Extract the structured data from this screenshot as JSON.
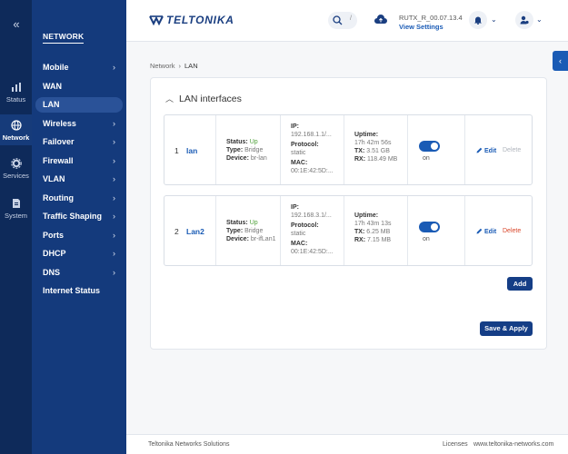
{
  "rail": {
    "items": [
      {
        "label": "Status",
        "icon": "bar-chart-icon"
      },
      {
        "label": "Network",
        "icon": "globe-icon"
      },
      {
        "label": "Services",
        "icon": "gear-icon"
      },
      {
        "label": "System",
        "icon": "system-icon"
      }
    ]
  },
  "subnav": {
    "title": "NETWORK",
    "items": [
      {
        "label": "Mobile",
        "chevron": true
      },
      {
        "label": "WAN",
        "chevron": false
      },
      {
        "label": "LAN",
        "chevron": false,
        "active": true
      },
      {
        "label": "Wireless",
        "chevron": true
      },
      {
        "label": "Failover",
        "chevron": true
      },
      {
        "label": "Firewall",
        "chevron": true
      },
      {
        "label": "VLAN",
        "chevron": true
      },
      {
        "label": "Routing",
        "chevron": true
      },
      {
        "label": "Traffic Shaping",
        "chevron": true
      },
      {
        "label": "Ports",
        "chevron": true
      },
      {
        "label": "DHCP",
        "chevron": true
      },
      {
        "label": "DNS",
        "chevron": true
      },
      {
        "label": "Internet Status",
        "chevron": false
      }
    ]
  },
  "header": {
    "logo_text": "TELTONIKA",
    "search_shortcut": "/",
    "firmware": "RUTX_R_00.07.13.4",
    "view_settings": "View Settings"
  },
  "breadcrumb": {
    "parent": "Network",
    "current": "LAN"
  },
  "panel": {
    "title": "LAN interfaces",
    "add_label": "Add",
    "save_label": "Save & Apply"
  },
  "interfaces": [
    {
      "index": "1",
      "name": "lan",
      "status_key": "Status:",
      "status": "Up",
      "type_key": "Type:",
      "type": "Bridge",
      "device_key": "Device:",
      "device": "br-lan",
      "ip_key": "IP:",
      "ip": "192.168.1.1/...",
      "protocol_key": "Protocol:",
      "protocol": "static",
      "mac_key": "MAC:",
      "mac": "00:1E:42:5D:...",
      "uptime_key": "Uptime:",
      "uptime": "17h 42m 56s",
      "tx_key": "TX:",
      "tx": "3.51 GB",
      "rx_key": "RX:",
      "rx": "118.49 MB",
      "toggle": "on",
      "edit": "Edit",
      "delete": "Delete",
      "delete_enabled": false
    },
    {
      "index": "2",
      "name": "Lan2",
      "status_key": "Status:",
      "status": "Up",
      "type_key": "Type:",
      "type": "Bridge",
      "device_key": "Device:",
      "device": "br-ifLan1",
      "ip_key": "IP:",
      "ip": "192.168.3.1/...",
      "protocol_key": "Protocol:",
      "protocol": "static",
      "mac_key": "MAC:",
      "mac": "00:1E:42:5D:...",
      "uptime_key": "Uptime:",
      "uptime": "17h 43m 13s",
      "tx_key": "TX:",
      "tx": "6.25 MB",
      "rx_key": "RX:",
      "rx": "7.15 MB",
      "toggle": "on",
      "edit": "Edit",
      "delete": "Delete",
      "delete_enabled": true
    }
  ],
  "footer": {
    "company": "Teltonika Networks Solutions",
    "licenses": "Licenses",
    "website": "www.teltonika-networks.com"
  },
  "colors": {
    "rail": "#0e2a5a",
    "subnav": "#143a7c",
    "accent": "#1a5bb5",
    "status_up": "#4fa13a",
    "delete": "#d9472b"
  }
}
